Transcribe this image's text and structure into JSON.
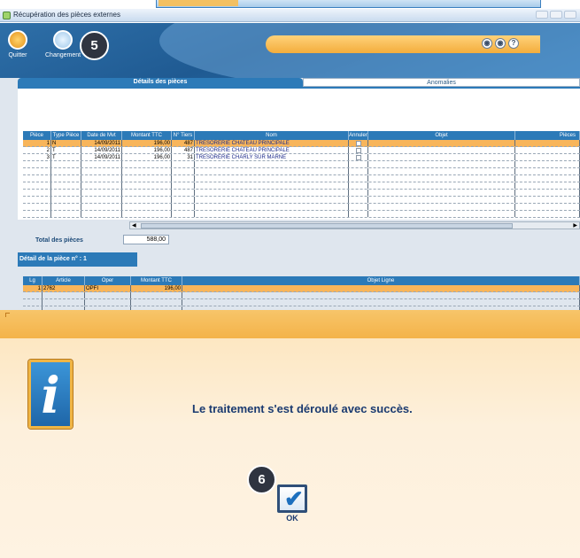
{
  "window": {
    "title": "Récupération des pièces externes"
  },
  "toolbar": {
    "quit_label": "Quitter",
    "change_label": "Changement",
    "step_badge": "5",
    "nav": [
      "◉",
      "◉",
      "?"
    ]
  },
  "tabs": [
    {
      "label": "Détails des pièces",
      "active": true
    },
    {
      "label": "Anomalies",
      "active": false
    }
  ],
  "pieces_table": {
    "columns": [
      "Pièce",
      "Type Pièce",
      "Date de Mvt",
      "Montant TTC",
      "N° Tiers",
      "Nom",
      "Annuler",
      "Objet",
      "Pièces"
    ],
    "rows": [
      {
        "piece": "1",
        "type": "N",
        "date": "14/09/2011",
        "montant": "196,00",
        "tiers": "487",
        "nom": "TRESORERIE CHATEAU PRINCIPALE",
        "selected": true
      },
      {
        "piece": "2",
        "type": "T",
        "date": "14/09/2011",
        "montant": "196,00",
        "tiers": "487",
        "nom": "TRESORERIE CHATEAU PRINCIPALE",
        "selected": false
      },
      {
        "piece": "3",
        "type": "T",
        "date": "14/09/2011",
        "montant": "196,00",
        "tiers": "31",
        "nom": "TRESORERIE CHARLY SUR MARNE",
        "selected": false
      }
    ]
  },
  "totals": {
    "label": "Total des pièces",
    "value": "588,00"
  },
  "detail": {
    "label": "Détail de la pièce n° : 1",
    "columns": [
      "Lg",
      "Article",
      "Oper",
      "Montant TTC",
      "Objet Ligne"
    ],
    "rows": [
      {
        "lg": "1",
        "article": "2762",
        "oper": "OPFI",
        "montant": "196,00",
        "objet": ""
      }
    ]
  },
  "dialog": {
    "message": "Le traitement s'est déroulé avec succès.",
    "ok_label": "OK",
    "step_badge": "6"
  },
  "colors": {
    "accent_blue": "#2c7ab8",
    "selection_orange": "#f8b55a",
    "dialog_bg": "#fdefd8"
  }
}
